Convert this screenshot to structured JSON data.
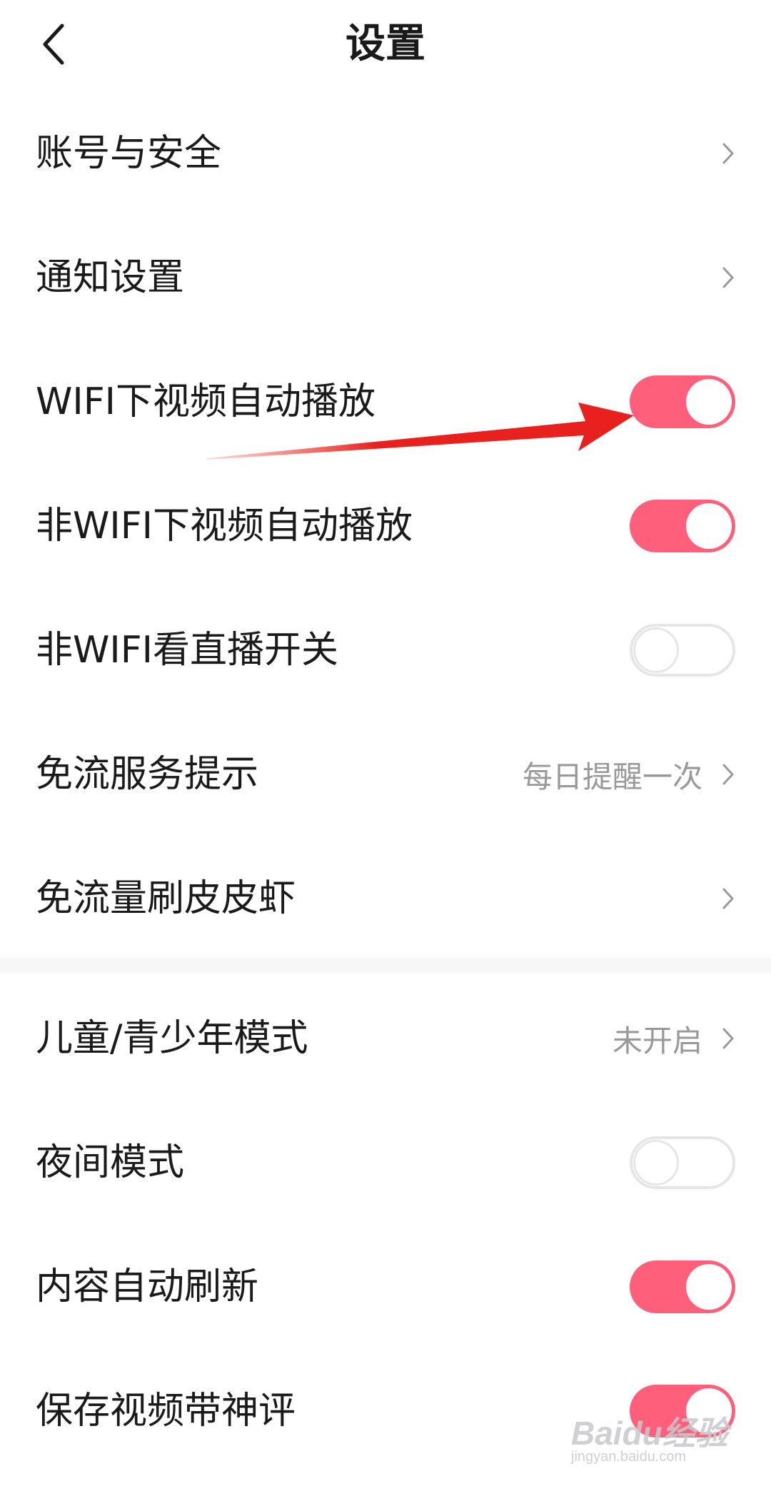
{
  "header": {
    "title": "设置",
    "back_icon": "chevron-left-icon"
  },
  "settings_group_1": [
    {
      "label": "账号与安全",
      "type": "link"
    },
    {
      "label": "通知设置",
      "type": "link"
    },
    {
      "label": "WIFI下视频自动播放",
      "type": "toggle",
      "on": true
    },
    {
      "label": "非WIFI下视频自动播放",
      "type": "toggle",
      "on": true
    },
    {
      "label": "非WIFI看直播开关",
      "type": "toggle",
      "on": false
    },
    {
      "label": "免流服务提示",
      "type": "link",
      "value": "每日提醒一次"
    },
    {
      "label": "免流量刷皮皮虾",
      "type": "link"
    }
  ],
  "settings_group_2": [
    {
      "label": "儿童/青少年模式",
      "type": "link",
      "value": "未开启"
    },
    {
      "label": "夜间模式",
      "type": "toggle",
      "on": false
    },
    {
      "label": "内容自动刷新",
      "type": "toggle",
      "on": true
    },
    {
      "label": "保存视频带神评",
      "type": "toggle",
      "on": true
    }
  ],
  "colors": {
    "toggle_on": "#fe5f7a",
    "toggle_off_border": "#e6e6e9",
    "secondary_text": "#999999",
    "annotation_arrow": "#e8201e"
  },
  "watermark": {
    "brand": "Baidu经验",
    "url": "jingyan.baidu.com"
  }
}
